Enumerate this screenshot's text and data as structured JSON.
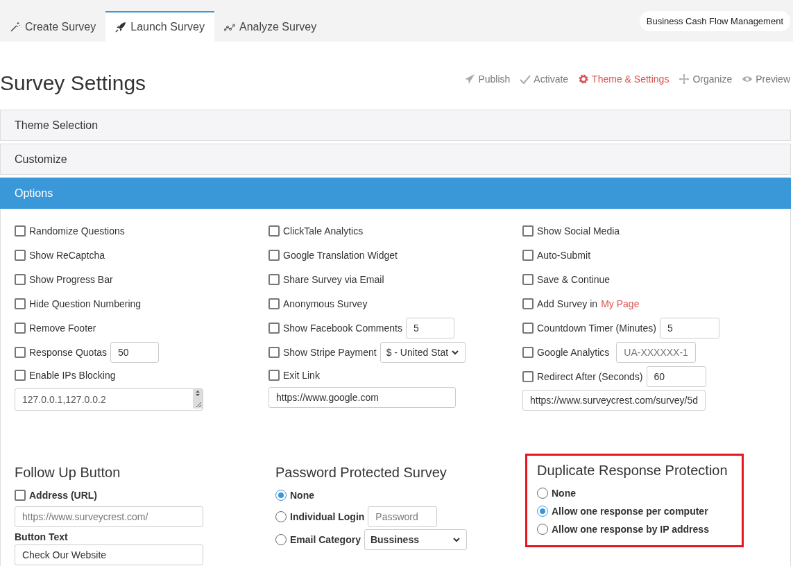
{
  "tabs": [
    {
      "label": "Create Survey",
      "selected": false
    },
    {
      "label": "Launch Survey",
      "selected": true
    },
    {
      "label": "Analyze Survey",
      "selected": false
    }
  ],
  "survey_selector": {
    "value": "Business Cash Flow Management"
  },
  "page_title": "Survey Settings",
  "steps": [
    {
      "label": "Publish",
      "selected": false
    },
    {
      "label": "Activate",
      "selected": false
    },
    {
      "label": "Theme & Settings",
      "selected": true
    },
    {
      "label": "Organize",
      "selected": false
    },
    {
      "label": "Preview",
      "selected": false
    }
  ],
  "accordion": [
    {
      "label": "Theme Selection",
      "expanded": false
    },
    {
      "label": "Customize",
      "expanded": false
    },
    {
      "label": "Options",
      "expanded": true
    }
  ],
  "options": {
    "columns": [
      [
        {
          "kind": "check",
          "label": "Randomize Questions",
          "checked": false
        },
        {
          "kind": "check",
          "label": "Show ReCaptcha",
          "checked": false
        },
        {
          "kind": "check",
          "label": "Show Progress Bar",
          "checked": false
        },
        {
          "kind": "check",
          "label": "Hide Question Numbering",
          "checked": false
        },
        {
          "kind": "check",
          "label": "Remove Footer",
          "checked": false
        },
        {
          "kind": "check-input",
          "label": "Response Quotas",
          "checked": false,
          "value": "50"
        },
        {
          "kind": "check",
          "label": "Enable IPs Blocking",
          "checked": false
        },
        {
          "kind": "textarea",
          "value": "127.0.0.1,127.0.0.2"
        }
      ],
      [
        {
          "kind": "check",
          "label": "ClickTale Analytics",
          "checked": false
        },
        {
          "kind": "check",
          "label": "Google Translation Widget",
          "checked": false
        },
        {
          "kind": "check",
          "label": "Share Survey via Email",
          "checked": false
        },
        {
          "kind": "check",
          "label": "Anonymous Survey",
          "checked": false
        },
        {
          "kind": "check-input",
          "label": "Show Facebook Comments",
          "checked": false,
          "value": "5"
        },
        {
          "kind": "check-select",
          "label": "Show Stripe Payment",
          "checked": false,
          "value": "$ - United Stat"
        },
        {
          "kind": "check",
          "label": "Exit Link",
          "checked": false
        },
        {
          "kind": "field",
          "value": "https://www.google.com"
        }
      ],
      [
        {
          "kind": "check",
          "label": "Show Social Media",
          "checked": false
        },
        {
          "kind": "check",
          "label": "Auto-Submit",
          "checked": false
        },
        {
          "kind": "check",
          "label": "Save & Continue",
          "checked": false
        },
        {
          "kind": "check-link",
          "label": "Add Survey in",
          "link": "My Page",
          "checked": false
        },
        {
          "kind": "check-input",
          "label": "Countdown Timer (Minutes)",
          "checked": false,
          "value": "5"
        },
        {
          "kind": "check-input",
          "label": "Google Analytics",
          "checked": false,
          "placeholder": "UA-XXXXXX-1"
        },
        {
          "kind": "check-input",
          "label": "Redirect After (Seconds)",
          "checked": false,
          "value": "60"
        },
        {
          "kind": "field",
          "value": "https://www.surveycrest.com/survey/5d"
        }
      ]
    ]
  },
  "sections": [
    {
      "title": "Follow Up Button",
      "highlighted": false,
      "items": [
        {
          "kind": "check",
          "label": "Address (URL)",
          "checked": false
        },
        {
          "kind": "field",
          "placeholder": "https://www.surveycrest.com/"
        },
        {
          "kind": "label",
          "label": "Button Text"
        },
        {
          "kind": "field",
          "value": "Check Our Website"
        }
      ]
    },
    {
      "title": "Password Protected Survey",
      "highlighted": false,
      "items": [
        {
          "kind": "radio",
          "label": "None",
          "selected": true
        },
        {
          "kind": "radio-input",
          "label": "Individual Login",
          "selected": false,
          "placeholder": "Password"
        },
        {
          "kind": "radio-select",
          "label": "Email Category",
          "selected": false,
          "value": "Bussiness"
        }
      ]
    },
    {
      "title": "Duplicate Response Protection",
      "highlighted": true,
      "items": [
        {
          "kind": "radio",
          "label": "None",
          "selected": false
        },
        {
          "kind": "radio",
          "label": "Allow one response per computer",
          "selected": true
        },
        {
          "kind": "radio",
          "label": "Allow one response by IP address",
          "selected": false
        }
      ]
    }
  ]
}
